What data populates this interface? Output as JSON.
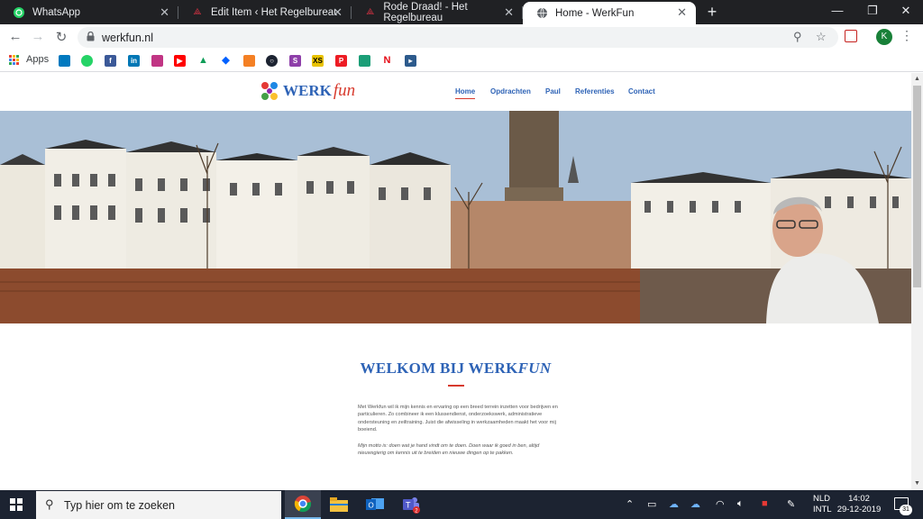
{
  "browser": {
    "tabs": [
      {
        "title": "WhatsApp",
        "favicon": "whatsapp-icon",
        "active": false
      },
      {
        "title": "Edit Item ‹ Het Regelbureau — W",
        "favicon": "wordpress-icon",
        "active": false
      },
      {
        "title": "Rode Draad! - Het Regelbureau",
        "favicon": "wordpress-icon",
        "active": false
      },
      {
        "title": "Home - WerkFun",
        "favicon": "globe-icon",
        "active": true
      }
    ],
    "url": "werkfun.nl",
    "profile_initial": "K",
    "bookmarks_apps_label": "Apps"
  },
  "site": {
    "logo": {
      "werk": "WERK",
      "fun": "fun"
    },
    "nav": [
      {
        "label": "Home",
        "active": true
      },
      {
        "label": "Opdrachten",
        "active": false
      },
      {
        "label": "Paul",
        "active": false
      },
      {
        "label": "Referenties",
        "active": false
      },
      {
        "label": "Contact",
        "active": false
      }
    ],
    "welcome": {
      "title_prefix": "WELKOM BIJ WERK",
      "title_emphasis": "FUN",
      "intro": "Met Werkfun wil ik mijn kennis en ervaring op een breed terrein inzetten voor bedrijven en particulieren. Zo combineer ik een klussendienst, onderzoekswerk, administratieve ondersteuning en zeiltraining. Juist die afwisseling in werkzaamheden maakt het voor mij boeiend.",
      "motto": "Mijn motto is: doen wat je hand vindt om te doen. Doen waar ik goed in ben, altijd nieuwsgierig om kennis uit te breiden en nieuwe dingen op te pakken."
    }
  },
  "taskbar": {
    "search_placeholder": "Typ hier om te zoeken",
    "language_line1": "NLD",
    "language_line2": "INTL",
    "time": "14:02",
    "date": "29-12-2019",
    "notification_count": "31",
    "teams_badge": "2"
  },
  "colors": {
    "brand_blue": "#2e63b6",
    "brand_red": "#d73a2d"
  }
}
